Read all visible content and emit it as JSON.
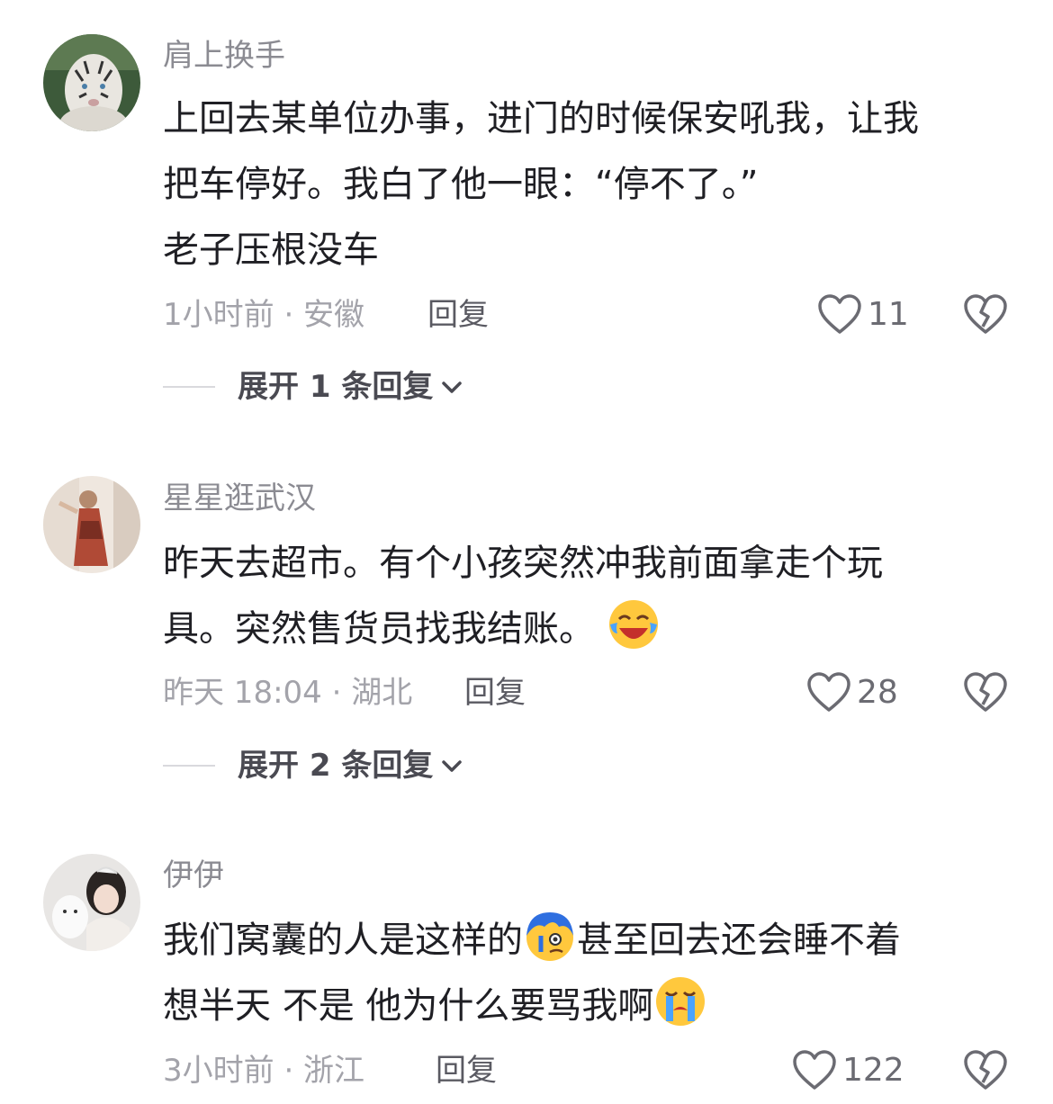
{
  "comments": [
    {
      "username": "肩上换手",
      "lines": [
        "上回去某单位办事，进门的时候保安吼我，让我",
        "把车停好。我白了他一眼：“停不了。”",
        "老子压根没车"
      ],
      "meta": "1小时前 · 安徽",
      "reply_label": "回复",
      "likes": "11",
      "expand_label": "展开 1 条回复",
      "avatar_icon": "white-tiger-avatar"
    },
    {
      "username": "星星逛武汉",
      "lines": [
        "昨天去超市。有个小孩突然冲我前面拿走个玩",
        "具。突然售货员找我结账。"
      ],
      "meta": "昨天 18:04 · 湖北",
      "reply_label": "回复",
      "likes": "28",
      "expand_label": "展开 2 条回复",
      "avatar_icon": "woman-in-dress-avatar",
      "emoji_icon": "laughing-crying-emoji"
    },
    {
      "username": "伊伊",
      "line1_a": "我们窝囊的人是这样的",
      "line1_b": "甚至回去还会睡不着",
      "line2": "想半天 不是 他为什么要骂我啊",
      "meta": "3小时前 · 浙江",
      "reply_label": "回复",
      "likes": "122",
      "avatar_icon": "girl-with-cat-avatar",
      "emoji1_icon": "blue-hair-awkward-emoji",
      "emoji2_icon": "crying-face-emoji"
    }
  ],
  "colors": {
    "text": "#1f1f24",
    "meta": "#a3a3aa",
    "username": "#8b8b92"
  }
}
